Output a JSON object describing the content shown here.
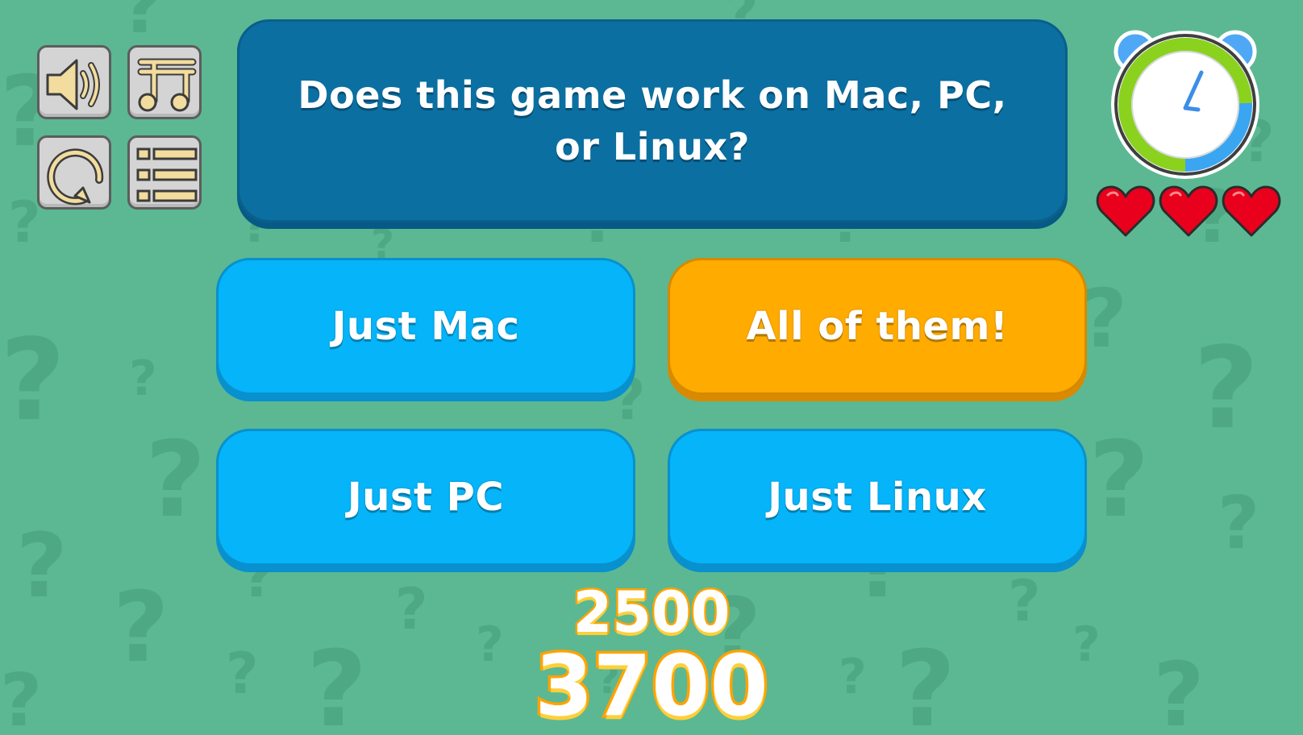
{
  "question": {
    "text": "Does this game work on Mac, PC, or Linux?"
  },
  "answers": [
    {
      "label": "Just Mac",
      "color": "#05b4f9"
    },
    {
      "label": "All of them!",
      "color": "#ffab00"
    },
    {
      "label": "Just PC",
      "color": "#05b4f9"
    },
    {
      "label": "Just Linux",
      "color": "#05b4f9"
    }
  ],
  "controls": [
    {
      "name": "sound-button",
      "icon": "speaker-icon"
    },
    {
      "name": "music-button",
      "icon": "music-note-icon"
    },
    {
      "name": "restart-button",
      "icon": "restart-icon"
    },
    {
      "name": "menu-button",
      "icon": "list-menu-icon"
    }
  ],
  "score": {
    "points_awarded": "2500",
    "total": "3700"
  },
  "lives": 3,
  "timer_icon": "alarm-clock-icon",
  "colors": {
    "background": "#5bb893",
    "question_box": "#0b6fa1",
    "answer_blue": "#05b4f9",
    "answer_highlight": "#ffab00",
    "score_outline": "#ffa300",
    "heart": "#e8001d"
  }
}
